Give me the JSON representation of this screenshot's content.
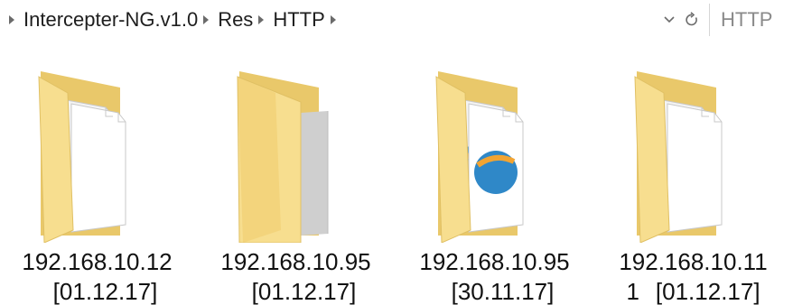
{
  "addressbar": {
    "breadcrumbs": [
      "Intercepter-NG.v1.0",
      "Res",
      "HTTP"
    ],
    "search_text": "HTTP",
    "dropdown_icon": "chevron-down-icon",
    "refresh_icon": "refresh-icon"
  },
  "items": [
    {
      "name": "192.168.10.12",
      "date": "[01.12.17]",
      "prefix": "",
      "icon": "folder-documents-icon"
    },
    {
      "name": "192.168.10.95",
      "date": "[01.12.17]",
      "prefix": "",
      "icon": "folder-gray-file-icon"
    },
    {
      "name": "192.168.10.95",
      "date": "[30.11.17]",
      "prefix": "",
      "icon": "folder-browser-files-icon"
    },
    {
      "name": "192.168.10.11",
      "date": "[01.12.17]",
      "prefix": "1",
      "icon": "folder-documents-icon"
    }
  ],
  "colors": {
    "folder_back": "#e9c86a",
    "folder_front": "#f7de8f",
    "page": "#ffffff",
    "accent_blue": "#2f88c8",
    "accent_orange": "#f2a432"
  }
}
